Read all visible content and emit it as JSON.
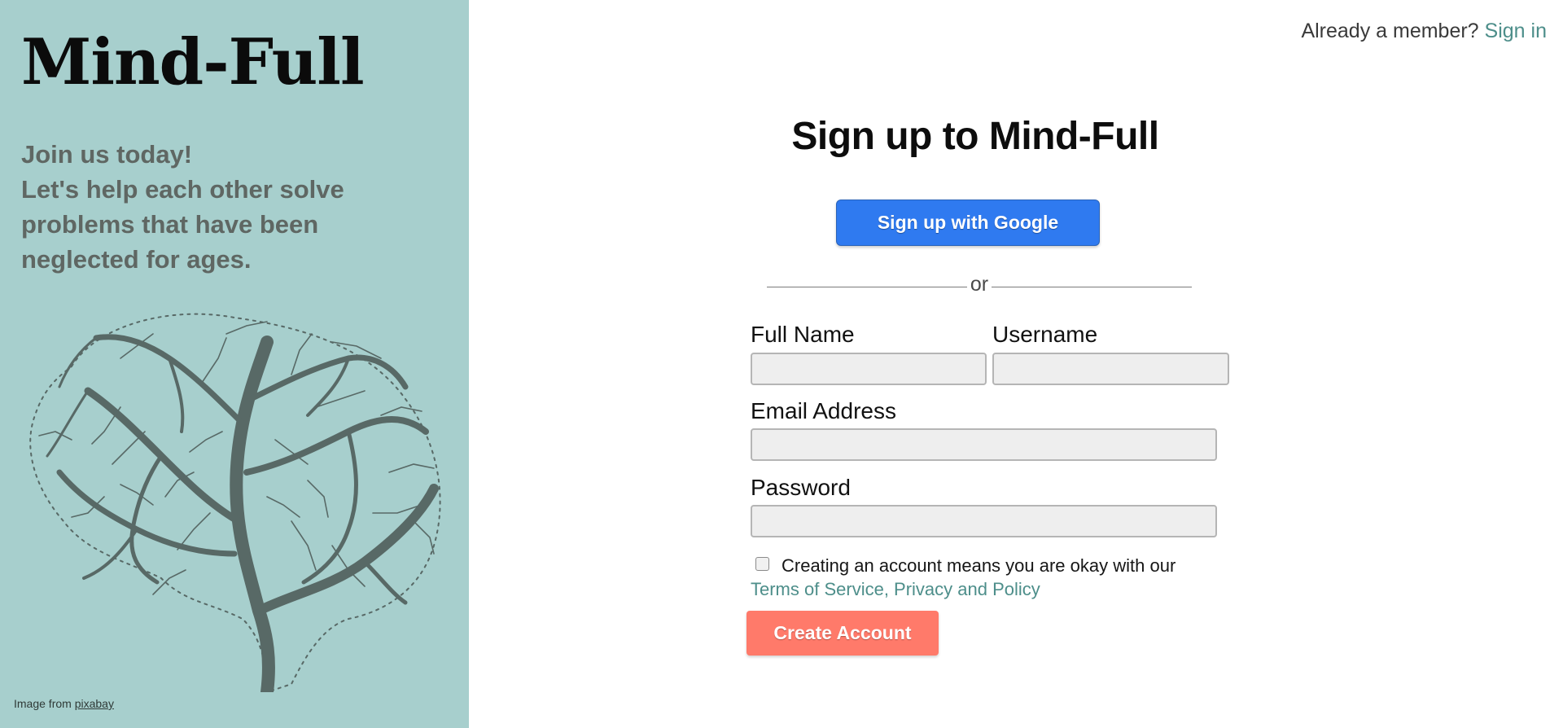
{
  "colors": {
    "panel_bg": "#a7cfcd",
    "brain_fill": "#586966",
    "accent_link": "#4d8e8a",
    "google_button": "#2f7af0",
    "create_button": "#ff7a6a",
    "input_bg": "#eeeeee"
  },
  "left_panel": {
    "brand": "Mind-Full",
    "tagline_line1": "Join us today!",
    "tagline_line2": "Let's help each other solve problems that have been neglected for ages.",
    "credit_prefix": "Image from",
    "credit_link": "pixabay",
    "image_icon": "tree-brain-illustration"
  },
  "header": {
    "member_prompt": "Already a member?",
    "sign_in_link": "Sign in"
  },
  "form": {
    "title": "Sign up to Mind-Full",
    "google_button": "Sign up with Google",
    "divider_text": "or",
    "full_name_label": "Full Name",
    "full_name_value": "",
    "username_label": "Username",
    "username_value": "",
    "email_label": "Email Address",
    "email_value": "",
    "password_label": "Password",
    "password_value": "",
    "terms_checked": false,
    "terms_prefix": "Creating an account means you are okay with our",
    "terms_link": "Terms of Service, Privacy and Policy",
    "submit_button": "Create Account"
  }
}
